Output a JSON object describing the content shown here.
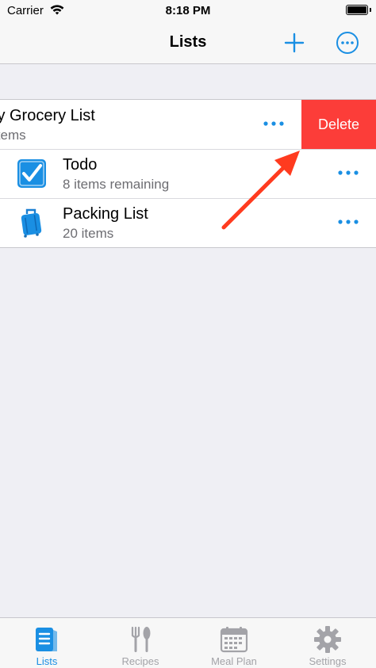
{
  "status": {
    "carrier": "Carrier",
    "time": "8:18 PM"
  },
  "nav": {
    "title": "Lists",
    "add_icon": "plus-icon",
    "more_icon": "ellipsis-circle-icon"
  },
  "colors": {
    "accent": "#1a8fe3",
    "delete": "#fc3d39",
    "arrow": "#ff3b1f",
    "inactive": "#a3a3a8"
  },
  "lists": {
    "items": [
      {
        "title": "ly Grocery List",
        "subtitle": "items",
        "action_label": "Delete"
      },
      {
        "title": "Todo",
        "subtitle": "8 items remaining",
        "icon": "checkbox-icon"
      },
      {
        "title": "Packing List",
        "subtitle": "20 items",
        "icon": "suitcase-icon"
      }
    ]
  },
  "tabs": [
    {
      "label": "Lists",
      "icon": "lists-icon",
      "active": true
    },
    {
      "label": "Recipes",
      "icon": "fork-knife-icon",
      "active": false
    },
    {
      "label": "Meal Plan",
      "icon": "calendar-icon",
      "active": false
    },
    {
      "label": "Settings",
      "icon": "gear-icon",
      "active": false
    }
  ]
}
